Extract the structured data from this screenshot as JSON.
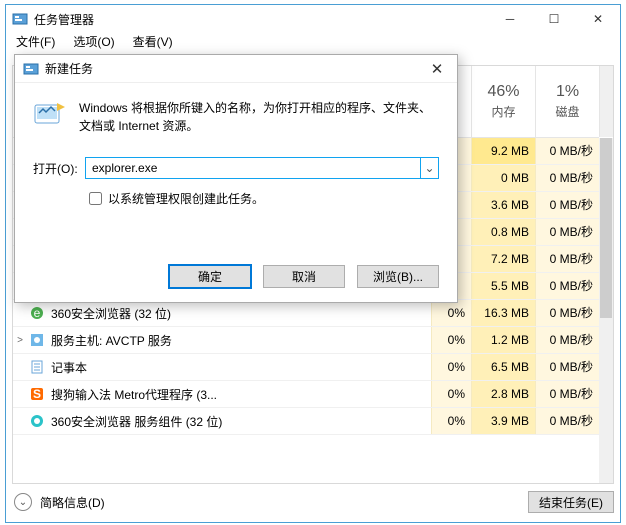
{
  "window": {
    "title": "任务管理器",
    "menu": [
      "文件(F)",
      "选项(O)",
      "查看(V)"
    ]
  },
  "table": {
    "columns": {
      "mem_pct": "46%",
      "mem_label": "内存",
      "disk_pct": "1%",
      "disk_label": "磁盘"
    },
    "rows": [
      {
        "name": "",
        "cpu": "",
        "mem": "9.2 MB",
        "disk": "0 MB/秒",
        "first": true,
        "icon": "none",
        "expand": ""
      },
      {
        "name": "",
        "cpu": "",
        "mem": "0 MB",
        "disk": "0 MB/秒",
        "icon": "none",
        "expand": ""
      },
      {
        "name": "",
        "cpu": "",
        "mem": "3.6 MB",
        "disk": "0 MB/秒",
        "icon": "none",
        "expand": ""
      },
      {
        "name": "",
        "cpu": "",
        "mem": "0.8 MB",
        "disk": "0 MB/秒",
        "icon": "none",
        "expand": ""
      },
      {
        "name": "",
        "cpu": "",
        "mem": "7.2 MB",
        "disk": "0 MB/秒",
        "icon": "none",
        "expand": ""
      },
      {
        "name": "",
        "cpu": "",
        "mem": "5.5 MB",
        "disk": "0 MB/秒",
        "icon": "none",
        "expand": ""
      },
      {
        "name": "360安全浏览器 (32 位)",
        "cpu": "0%",
        "mem": "16.3 MB",
        "disk": "0 MB/秒",
        "icon": "360e",
        "expand": ""
      },
      {
        "name": "服务主机: AVCTP 服务",
        "cpu": "0%",
        "mem": "1.2 MB",
        "disk": "0 MB/秒",
        "icon": "gear",
        "expand": ">"
      },
      {
        "name": "记事本",
        "cpu": "0%",
        "mem": "6.5 MB",
        "disk": "0 MB/秒",
        "icon": "notepad",
        "expand": ""
      },
      {
        "name": "搜狗输入法 Metro代理程序 (3...",
        "cpu": "0%",
        "mem": "2.8 MB",
        "disk": "0 MB/秒",
        "icon": "sogou",
        "expand": ""
      },
      {
        "name": "360安全浏览器 服务组件 (32 位)",
        "cpu": "0%",
        "mem": "3.9 MB",
        "disk": "0 MB/秒",
        "icon": "360c",
        "expand": ""
      }
    ]
  },
  "footer": {
    "brief_label": "简略信息(D)",
    "end_task": "结束任务(E)"
  },
  "dialog": {
    "title": "新建任务",
    "description": "Windows 将根据你所键入的名称，为你打开相应的程序、文件夹、文档或 Internet 资源。",
    "open_label": "打开(O):",
    "input_value": "explorer.exe",
    "admin_checkbox": "以系统管理权限创建此任务。",
    "ok": "确定",
    "cancel": "取消",
    "browse": "浏览(B)..."
  }
}
